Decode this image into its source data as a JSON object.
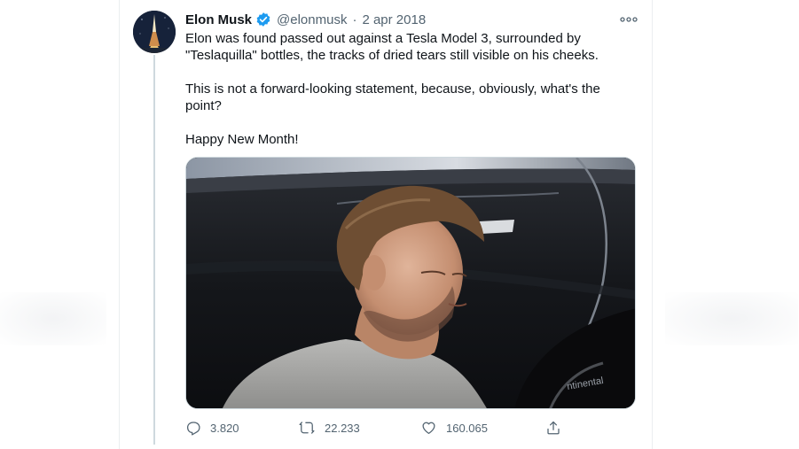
{
  "tweet": {
    "author": {
      "display_name": "Elon Musk",
      "handle": "@elonmusk",
      "verified": true,
      "avatar_icon": "rocket-launch-avatar"
    },
    "separator": "·",
    "date": "2 apr 2018",
    "text_paragraphs": [
      "Elon was found passed out against a Tesla Model 3, surrounded by \"Teslaquilla\" bottles, the tracks of dried tears still visible on his cheeks.",
      "This is not a forward-looking statement, because, obviously, what's the point?",
      "Happy New Month!"
    ],
    "media": {
      "icon": "photo-man-leaning-on-car"
    },
    "actions": {
      "replies": "3.820",
      "retweets": "22.233",
      "likes": "160.065"
    }
  },
  "colors": {
    "text_primary": "#0f1419",
    "text_secondary": "#536471",
    "verified_blue": "#1d9bf0",
    "border": "#cfd9de"
  }
}
